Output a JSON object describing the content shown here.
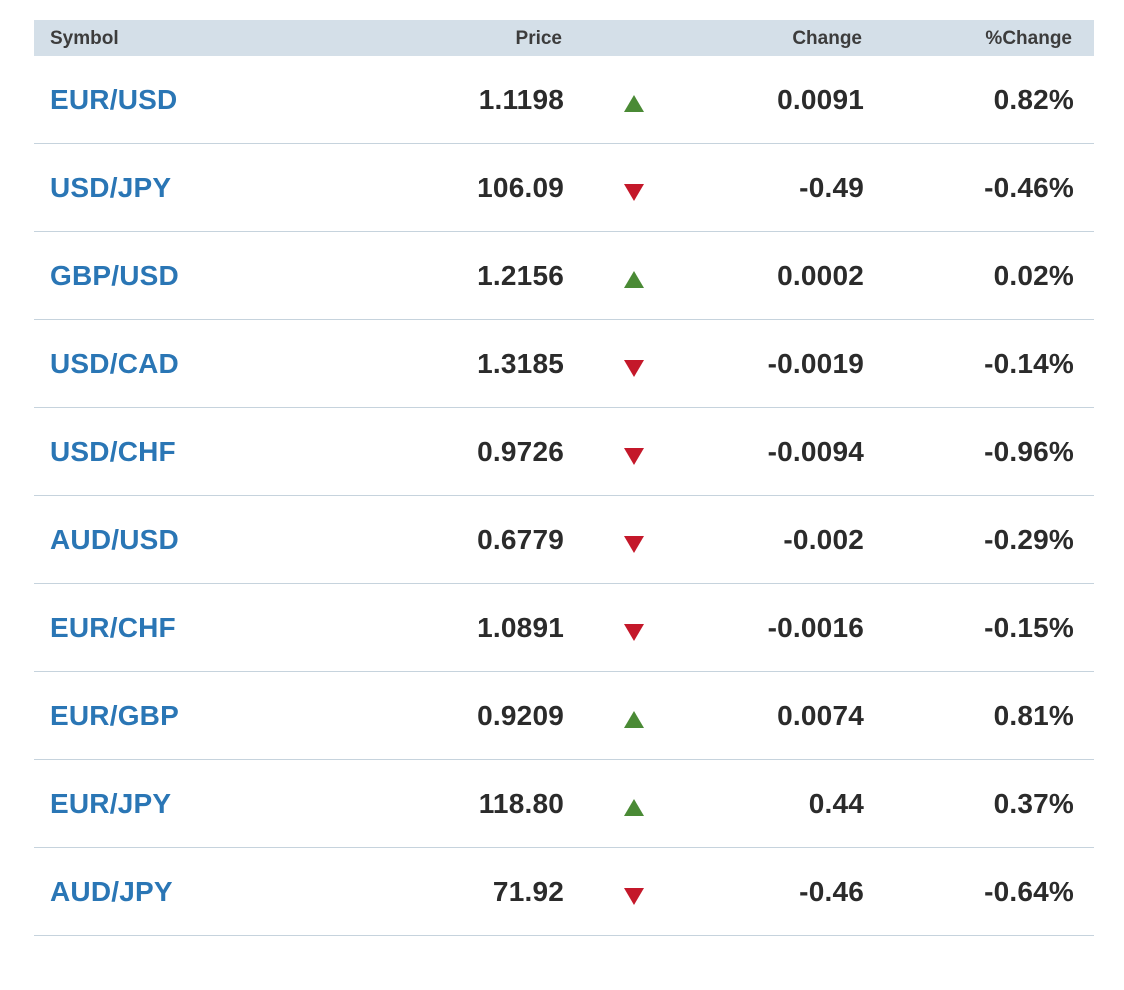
{
  "table": {
    "headers": {
      "symbol": "Symbol",
      "price": "Price",
      "change": "Change",
      "pct_change": "%Change"
    },
    "colors": {
      "symbol_link": "#2a76b5",
      "up": "#4a8a35",
      "down": "#c4182a",
      "header_bg": "#d4dfe8"
    },
    "rows": [
      {
        "symbol": "EUR/USD",
        "price": "1.1198",
        "direction": "up",
        "change": "0.0091",
        "pct_change": "0.82%"
      },
      {
        "symbol": "USD/JPY",
        "price": "106.09",
        "direction": "down",
        "change": "-0.49",
        "pct_change": "-0.46%"
      },
      {
        "symbol": "GBP/USD",
        "price": "1.2156",
        "direction": "up",
        "change": "0.0002",
        "pct_change": "0.02%"
      },
      {
        "symbol": "USD/CAD",
        "price": "1.3185",
        "direction": "down",
        "change": "-0.0019",
        "pct_change": "-0.14%"
      },
      {
        "symbol": "USD/CHF",
        "price": "0.9726",
        "direction": "down",
        "change": "-0.0094",
        "pct_change": "-0.96%"
      },
      {
        "symbol": "AUD/USD",
        "price": "0.6779",
        "direction": "down",
        "change": "-0.002",
        "pct_change": "-0.29%"
      },
      {
        "symbol": "EUR/CHF",
        "price": "1.0891",
        "direction": "down",
        "change": "-0.0016",
        "pct_change": "-0.15%"
      },
      {
        "symbol": "EUR/GBP",
        "price": "0.9209",
        "direction": "up",
        "change": "0.0074",
        "pct_change": "0.81%"
      },
      {
        "symbol": "EUR/JPY",
        "price": "118.80",
        "direction": "up",
        "change": "0.44",
        "pct_change": "0.37%"
      },
      {
        "symbol": "AUD/JPY",
        "price": "71.92",
        "direction": "down",
        "change": "-0.46",
        "pct_change": "-0.64%"
      }
    ]
  }
}
